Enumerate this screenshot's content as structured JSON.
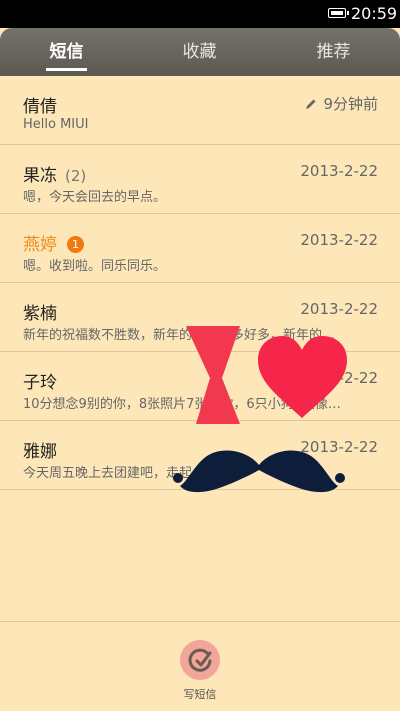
{
  "status": {
    "time": "20:59"
  },
  "tabs": [
    {
      "label": "短信",
      "active": true
    },
    {
      "label": "收藏",
      "active": false
    },
    {
      "label": "推荐",
      "active": false
    }
  ],
  "conversations": [
    {
      "name": "倩倩",
      "count": "",
      "unread": "",
      "time": "9分钟前",
      "preview": "Hello MIUI",
      "draft": true,
      "highlight": false
    },
    {
      "name": "果冻",
      "count": "(2)",
      "unread": "",
      "time": "2013-2-22",
      "preview": "嗯，今天会回去的早点。",
      "draft": false,
      "highlight": false
    },
    {
      "name": "燕婷",
      "count": "",
      "unread": "1",
      "time": "2013-2-22",
      "preview": "嗯。收到啦。同乐同乐。",
      "draft": false,
      "highlight": true
    },
    {
      "name": "紫楠",
      "count": "",
      "unread": "",
      "time": "2013-2-22",
      "preview": "新年的祝福数不胜数，新年的愿望好多好多，新年的…",
      "draft": false,
      "highlight": false
    },
    {
      "name": "子玲",
      "count": "",
      "unread": "",
      "time": "2013-2-22",
      "preview": "10分想念9别的你，8张照片7张是你，6只小狗5只像…",
      "draft": false,
      "highlight": false
    },
    {
      "name": "雅娜",
      "count": "",
      "unread": "",
      "time": "2013-2-22",
      "preview": "今天周五晚上去团建吧，走起",
      "draft": false,
      "highlight": false
    }
  ],
  "compose": {
    "label": "写短信"
  },
  "colors": {
    "background": "#fde7b9",
    "accent": "#f08a1a",
    "bow": "#f2384f",
    "heart": "#f5264a",
    "mustache": "#0e1d3a"
  }
}
